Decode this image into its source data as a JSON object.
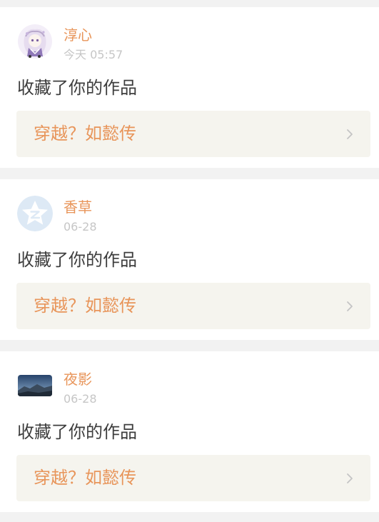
{
  "notifications": [
    {
      "avatar_icon": "anime-avatar",
      "username": "淳心",
      "time": "今天 05:57",
      "action": "收藏了你的作品",
      "work_title": "穿越？如懿传",
      "chevron_icon": "chevron-right-icon"
    },
    {
      "avatar_icon": "qzone-star-avatar",
      "username": "香草",
      "time": "06-28",
      "action": "收藏了你的作品",
      "work_title": "穿越？如懿传",
      "chevron_icon": "chevron-right-icon"
    },
    {
      "avatar_icon": "landscape-avatar",
      "username": "夜影",
      "time": "06-28",
      "action": "收藏了你的作品",
      "work_title": "穿越？如懿传",
      "chevron_icon": "chevron-right-icon"
    }
  ],
  "colors": {
    "page_background": "#f2f2f2",
    "card_background": "#ffffff",
    "accent": "#e8955a",
    "muted_text": "#c6c6c6",
    "body_text": "#3d3d3d",
    "work_link_background": "#f5f4ee"
  }
}
